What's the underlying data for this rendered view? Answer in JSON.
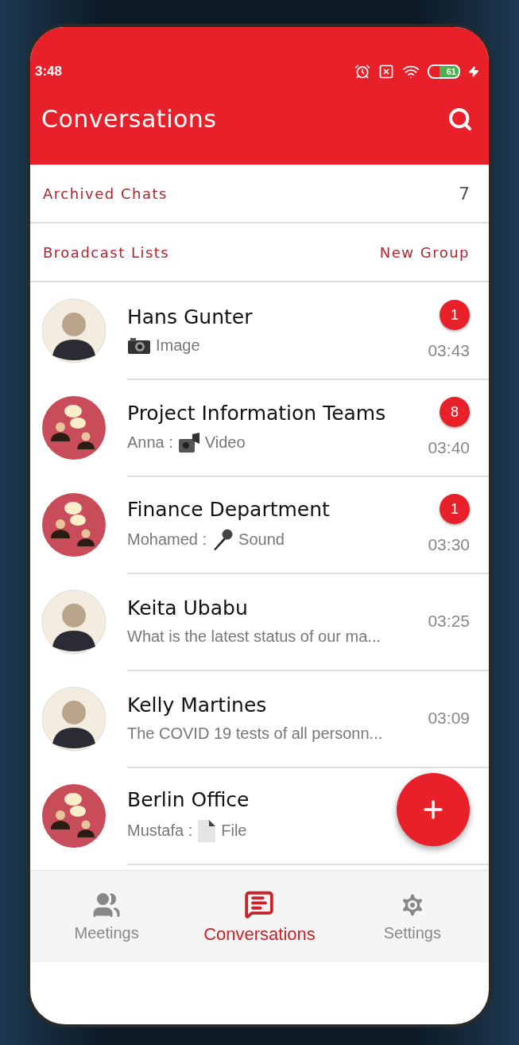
{
  "status_bar": {
    "time": "3:48",
    "battery": "61"
  },
  "app_bar": {
    "title": "Conversations"
  },
  "archived": {
    "label": "Archived Chats",
    "count": "7"
  },
  "links": {
    "left": "Broadcast Lists",
    "right": "New Group"
  },
  "chats": [
    {
      "name": "Hans Gunter",
      "kind": "person",
      "preview": {
        "kind": "image",
        "text": "Image"
      },
      "unread": "1",
      "time": "03:43"
    },
    {
      "name": "Project Information Teams",
      "kind": "group",
      "preview": {
        "sender": "Anna :",
        "kind": "video",
        "text": "Video"
      },
      "unread": "8",
      "time": "03:40"
    },
    {
      "name": "Finance Department",
      "kind": "group",
      "preview": {
        "sender": "Mohamed :",
        "kind": "sound",
        "text": "Sound"
      },
      "unread": "1",
      "time": "03:30"
    },
    {
      "name": "Keita Ubabu",
      "kind": "person",
      "preview": {
        "kind": "text",
        "text": "What is the latest status of our ma..."
      },
      "time": "03:25"
    },
    {
      "name": "Kelly Martines",
      "kind": "person",
      "preview": {
        "kind": "text",
        "text": "The COVID 19 tests of all personn..."
      },
      "time": "03:09"
    },
    {
      "name": "Berlin Office",
      "kind": "group",
      "preview": {
        "sender": "Mustafa :",
        "kind": "file",
        "text": "File"
      }
    }
  ],
  "nav": [
    {
      "kind": "meetings",
      "label": "Meetings",
      "selected": false
    },
    {
      "kind": "conversations",
      "label": "Conversations",
      "selected": true
    },
    {
      "kind": "settings",
      "label": "Settings",
      "selected": false
    }
  ]
}
